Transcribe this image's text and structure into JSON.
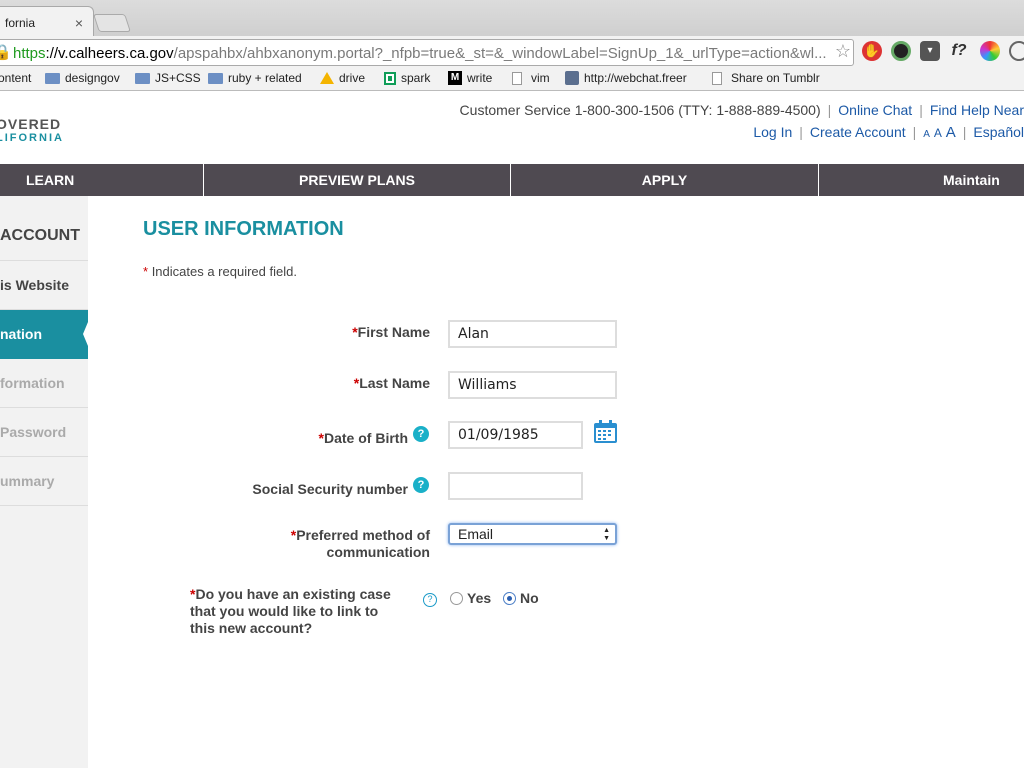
{
  "browser": {
    "tab_title": "fornia",
    "url_https": "https",
    "url_host": "://v.calheers.ca.gov",
    "url_path": "/apspahbx/ahbxanonym.portal?_nfpb=true&_st=&_windowLabel=SignUp_1&_urlType=action&wl...",
    "extension_f": "f?",
    "bookmarks": [
      {
        "label": "ontent",
        "icon": "page-icon"
      },
      {
        "label": "designgov",
        "icon": "folder-icon"
      },
      {
        "label": "JS+CSS",
        "icon": "folder-icon"
      },
      {
        "label": "ruby + related",
        "icon": "folder-icon"
      },
      {
        "label": "drive",
        "icon": "drive-icon"
      },
      {
        "label": "spark",
        "icon": "sheets-icon"
      },
      {
        "label": "write",
        "icon": "medium-icon"
      },
      {
        "label": "vim",
        "icon": "page-icon"
      },
      {
        "label": "http://webchat.freer",
        "icon": "webchat-icon"
      },
      {
        "label": "Share on Tumblr",
        "icon": "page-icon"
      }
    ]
  },
  "header": {
    "logo_line1": "OVERED",
    "logo_line2": "LIFORNIA",
    "customer_service": "Customer Service 1-800-300-1506 (TTY: 1-888-889-4500)",
    "online_chat": "Online Chat",
    "find_help": "Find Help Near",
    "login": "Log In",
    "create_account": "Create Account",
    "text_size": [
      "A",
      "A",
      "A"
    ],
    "espanol": "Español"
  },
  "nav": [
    "LEARN",
    "PREVIEW PLANS",
    "APPLY",
    "Maintain"
  ],
  "sidebar": {
    "heading": "ACCOUNT",
    "items": [
      "is Website",
      "nation",
      "formation",
      "Password",
      "ummary"
    ]
  },
  "form": {
    "title": "USER INFORMATION",
    "required_note": "Indicates a required field.",
    "first_name_label": "First Name",
    "first_name_value": "Alan",
    "last_name_label": "Last Name",
    "last_name_value": "Williams",
    "dob_label": "Date of Birth",
    "dob_value": "01/09/1985",
    "ssn_label": "Social Security number",
    "ssn_value": "",
    "comm_label_1": "Preferred method of",
    "comm_label_2": "communication",
    "comm_value": "Email",
    "case_label_1": "Do you have an existing case",
    "case_label_2": "that you would like to link to",
    "case_label_3": "this new account?",
    "yes_label": "Yes",
    "no_label": "No",
    "selected_option": "No",
    "help_glyph": "?",
    "required_marker": "*"
  },
  "colors": {
    "accent": "#1a8fa0",
    "nav_bg": "#4f4a51",
    "link": "#1d5aa7",
    "required": "#cc0000"
  }
}
